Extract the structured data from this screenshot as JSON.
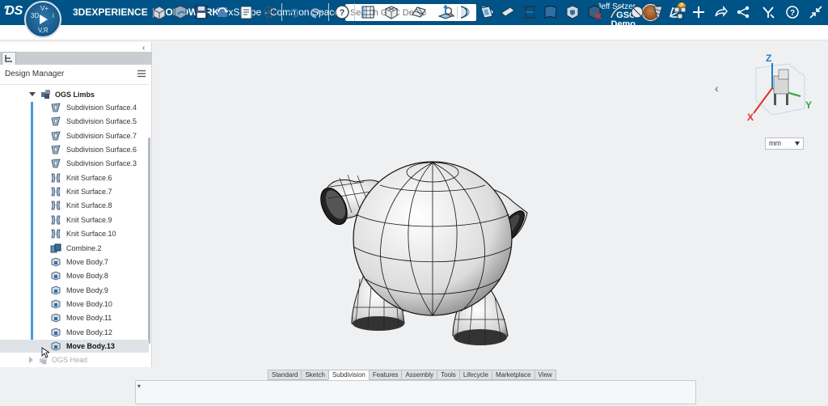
{
  "topbar": {
    "compass_quadrants": [
      "3D",
      "V+",
      "i",
      "V,R"
    ],
    "brand_3d": "3DEXPERIENCE",
    "brand_sep": "|",
    "brand_product": "SOLIDWORKS",
    "brand_app": "xShape - Common Space",
    "search_placeholder": "Search GSC Demo",
    "user_name": "Jeff Setzer",
    "user_org": "GSC Demo",
    "notification_count": "2"
  },
  "panel": {
    "title": "Design Manager",
    "group_label": "OGS Limbs",
    "items": [
      {
        "label": "Subdivision Surface.4",
        "type": "subdivision"
      },
      {
        "label": "Subdivision Surface.5",
        "type": "subdivision"
      },
      {
        "label": "Subdivision Surface.7",
        "type": "subdivision"
      },
      {
        "label": "Subdivision Surface.6",
        "type": "subdivision"
      },
      {
        "label": "Subdivision Surface.3",
        "type": "subdivision"
      },
      {
        "label": "Knit Surface.6",
        "type": "knit"
      },
      {
        "label": "Knit Surface.7",
        "type": "knit"
      },
      {
        "label": "Knit Surface.8",
        "type": "knit"
      },
      {
        "label": "Knit Surface.9",
        "type": "knit"
      },
      {
        "label": "Knit Surface.10",
        "type": "knit"
      },
      {
        "label": "Combine.2",
        "type": "combine"
      },
      {
        "label": "Move Body.7",
        "type": "move"
      },
      {
        "label": "Move Body.8",
        "type": "move"
      },
      {
        "label": "Move Body.9",
        "type": "move"
      },
      {
        "label": "Move Body.10",
        "type": "move"
      },
      {
        "label": "Move Body.11",
        "type": "move"
      },
      {
        "label": "Move Body.12",
        "type": "move"
      },
      {
        "label": "Move Body.13",
        "type": "move",
        "selected": true
      }
    ],
    "next_group_label": "OGS Head"
  },
  "viewport": {
    "axes": {
      "x": "X",
      "y": "Y",
      "z": "Z"
    },
    "unit": "mm"
  },
  "bottom": {
    "tabs": [
      "Standard",
      "Sketch",
      "Subdivision",
      "Features",
      "Assembly",
      "Tools",
      "Lifecycle",
      "Marketplace",
      "View"
    ],
    "active_tab": "Subdivision"
  },
  "colors": {
    "topbar": "#005386",
    "accent": "#4a9bd9",
    "axis_x": "#e0302b",
    "axis_y": "#2fa52f",
    "axis_z": "#1e7fd0"
  }
}
